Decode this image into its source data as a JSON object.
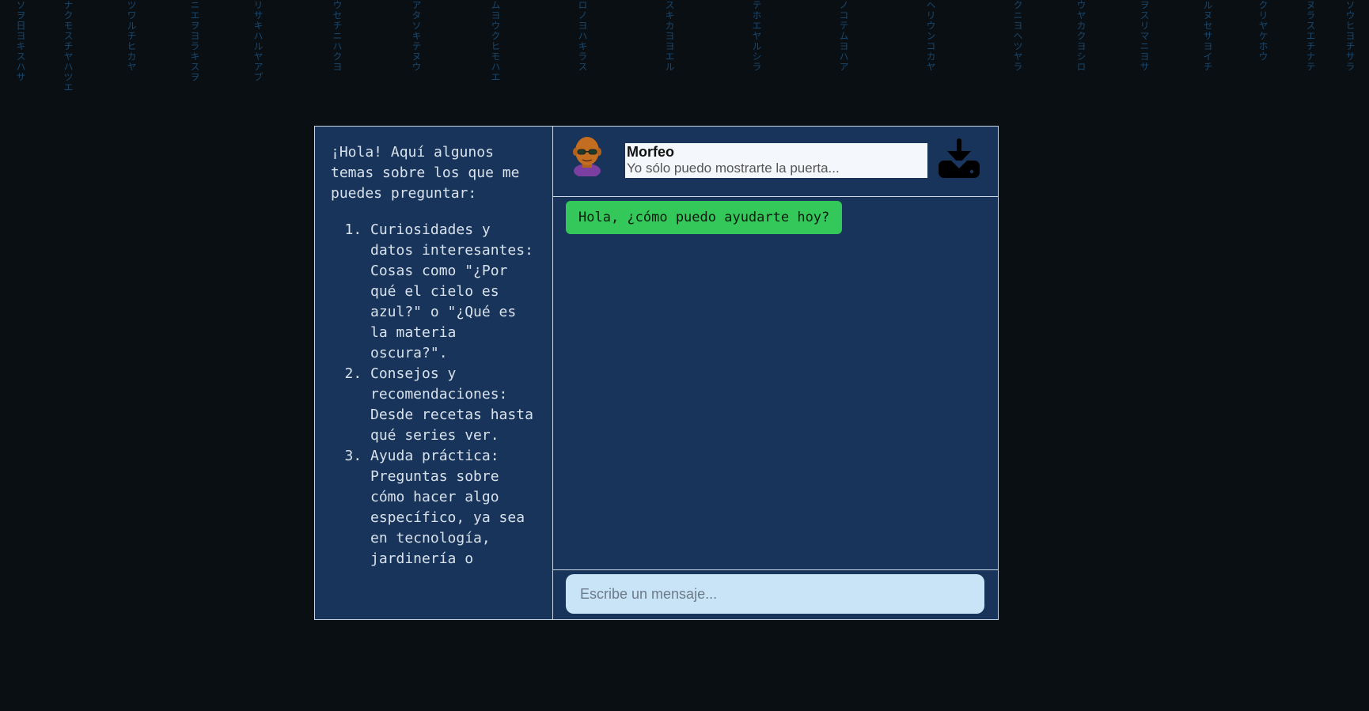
{
  "background": {
    "columns": [
      "ソヲ日ヨキスハサ",
      "ナクモスチヤハツエ",
      "ツワルチヒカヤ",
      "ニエヲヨラキスヲ",
      "リサキハルヤアプ",
      "ウセチニハクヨ",
      "アタソキテヌウ",
      "ムヨウクヒモハエ",
      "ロノヨハキラス",
      "スキカヨヨエル",
      "テホエヤルシラ",
      "ノコテムヨハア",
      "ヘリウンコカヤ",
      "クニヨヘツヤラ",
      "ウヤカクヨシロ",
      "ヲスリマニヨサ",
      "ルヌセサヨイチ",
      "クリヤケホウ",
      "ヌラスエチナテ",
      "ソウヒヨチサラ"
    ]
  },
  "sidebar": {
    "intro": "¡Hola! Aquí algunos temas sobre los que me puedes preguntar:",
    "topics": [
      "Curiosidades y datos interesantes: Cosas como \"¿Por qué el cielo es azul?\" o \"¿Qué es la materia oscura?\".",
      "Consejos y recomendaciones: Desde recetas hasta qué series ver.",
      "Ayuda práctica: Preguntas sobre cómo hacer algo específico, ya sea en tecnología, jardinería o"
    ]
  },
  "chat": {
    "contact_name": "Morfeo",
    "contact_status": "Yo sólo puedo mostrarte la puerta...",
    "avatar_icon": "morpheus-avatar-icon",
    "download_icon": "download-icon",
    "messages": [
      {
        "sender": "bot",
        "text": "Hola, ¿cómo puedo ayudarte hoy?"
      }
    ],
    "input_placeholder": "Escribe un mensaje...",
    "input_value": ""
  },
  "colors": {
    "page_bg": "#0a0f14",
    "matrix_text": "#1e5a8a",
    "panel_bg": "#19375f",
    "bubble_bg": "#34c759",
    "input_bg": "#c9e3f7"
  }
}
